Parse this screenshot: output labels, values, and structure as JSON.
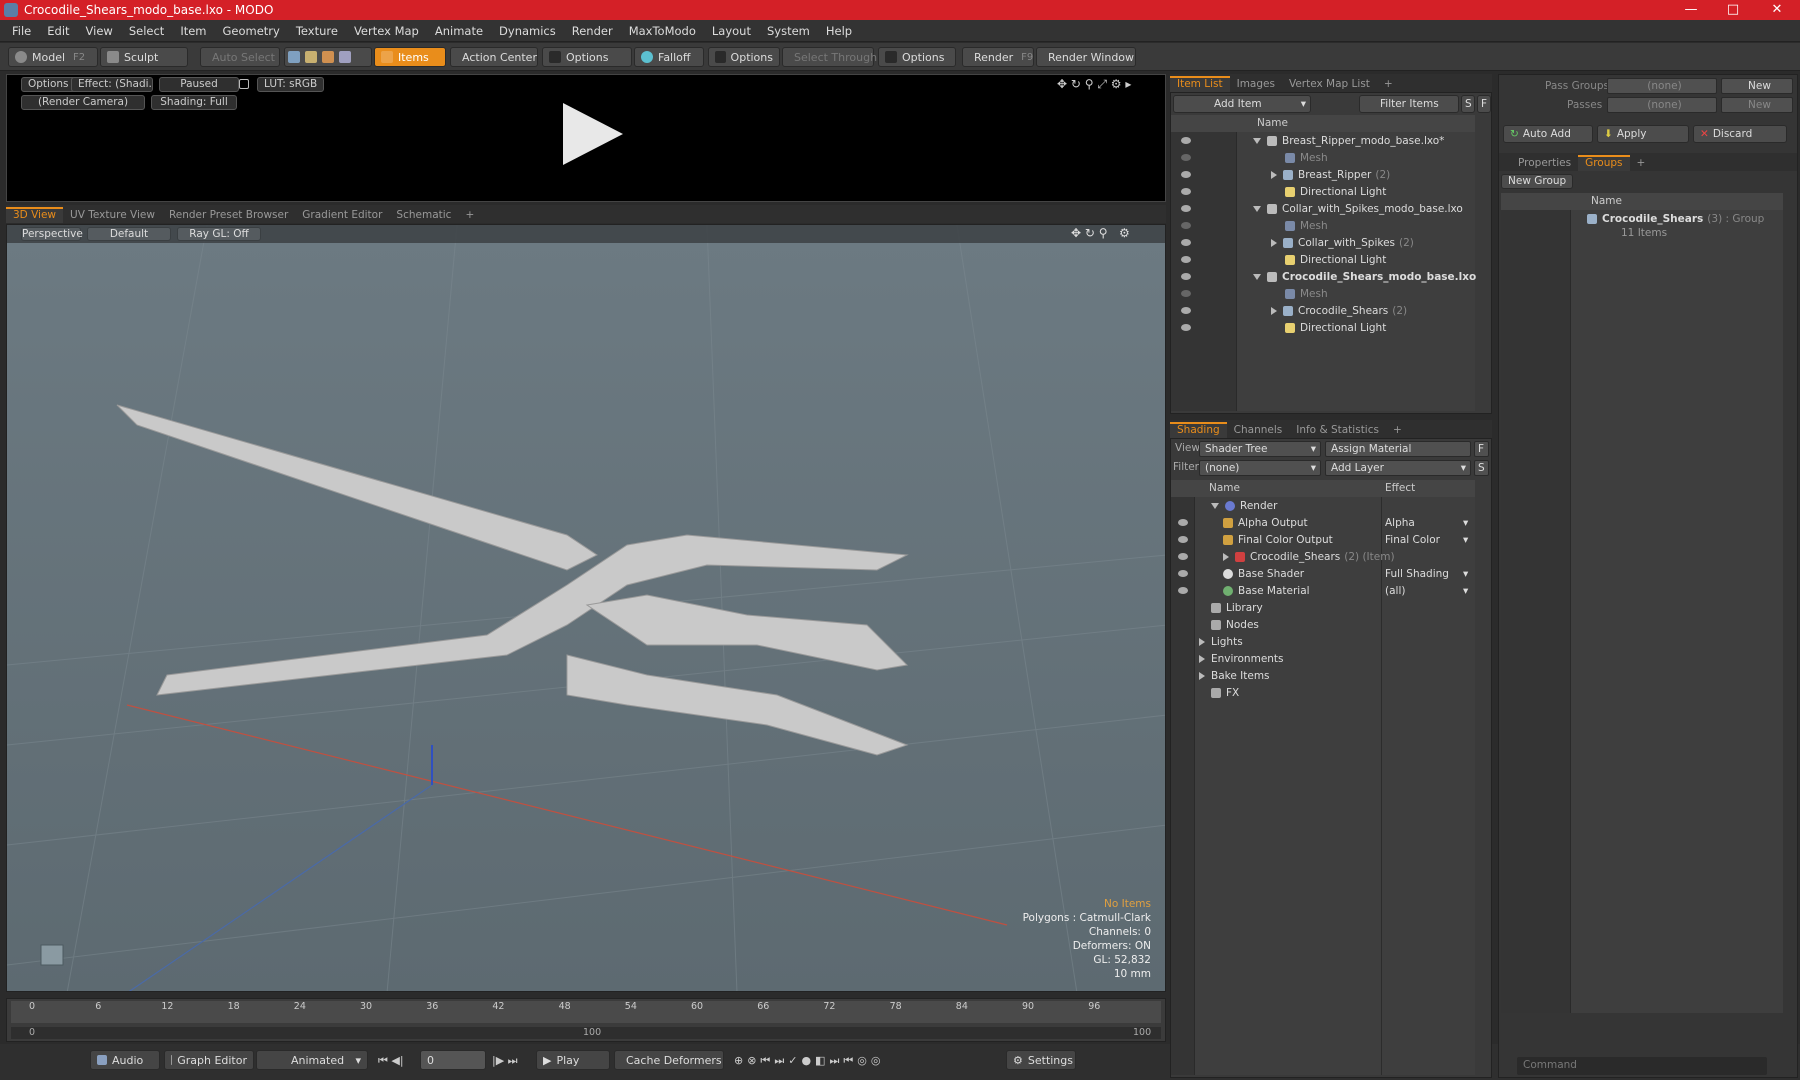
{
  "window": {
    "title": "Crocodile_Shears_modo_base.lxo - MODO",
    "minimize": "—",
    "maximize": "□",
    "close": "✕"
  },
  "menu": [
    "File",
    "Edit",
    "View",
    "Select",
    "Item",
    "Geometry",
    "Texture",
    "Vertex Map",
    "Animate",
    "Dynamics",
    "Render",
    "MaxToModo",
    "Layout",
    "System",
    "Help"
  ],
  "toolbar": {
    "model": "Model",
    "model_key": "F2",
    "sculpt": "Sculpt",
    "auto_select": "Auto Select",
    "items": "Items",
    "action_center": "Action Center",
    "options1": "Options",
    "falloff": "Falloff",
    "options2": "Options",
    "select_through": "Select Through",
    "options3": "Options",
    "render": "Render",
    "render_key": "F9",
    "render_window": "Render Window"
  },
  "preview": {
    "options": "Options",
    "effect": "Effect: (Shadi...",
    "paused": "Paused",
    "lut": "LUT: sRGB",
    "camera": "(Render Camera)",
    "shading": "Shading: Full"
  },
  "view_tabs": [
    "3D View",
    "UV Texture View",
    "Render Preset Browser",
    "Gradient Editor",
    "Schematic",
    "+"
  ],
  "viewport": {
    "perspective": "Perspective",
    "default": "Default",
    "raygl": "Ray GL: Off",
    "stats": {
      "no_items": "No Items",
      "polygons": "Polygons : Catmull-Clark",
      "channels": "Channels: 0",
      "deformers": "Deformers: ON",
      "gl": "GL: 52,832",
      "scale": "10 mm"
    }
  },
  "timeline": {
    "ticks": [
      "0",
      "6",
      "12",
      "18",
      "24",
      "30",
      "36",
      "42",
      "48",
      "54",
      "60",
      "66",
      "72",
      "78",
      "84",
      "90",
      "96"
    ],
    "low": "0",
    "mid": "100",
    "high": "100"
  },
  "bottom": {
    "audio": "Audio",
    "graph_editor": "Graph Editor",
    "animated": "Animated",
    "frame": "0",
    "play": "Play",
    "cache": "Cache Deformers",
    "settings": "Settings"
  },
  "item_list": {
    "tabs": [
      "Item List",
      "Images",
      "Vertex Map List",
      "+"
    ],
    "add_item": "Add Item",
    "filter_items": "Filter Items",
    "s": "S",
    "f": "F",
    "col_name": "Name",
    "rows": [
      {
        "label": "Breast_Ripper_modo_base.lxo*",
        "level": 0,
        "type": "scene"
      },
      {
        "label": "Mesh",
        "level": 1,
        "type": "mesh"
      },
      {
        "label": "Breast_Ripper",
        "count": "(2)",
        "level": 1,
        "type": "group"
      },
      {
        "label": "Directional Light",
        "level": 1,
        "type": "light"
      },
      {
        "label": "Collar_with_Spikes_modo_base.lxo",
        "level": 0,
        "type": "scene"
      },
      {
        "label": "Mesh",
        "level": 1,
        "type": "mesh"
      },
      {
        "label": "Collar_with_Spikes",
        "count": "(2)",
        "level": 1,
        "type": "group"
      },
      {
        "label": "Directional Light",
        "level": 1,
        "type": "light"
      },
      {
        "label": "Crocodile_Shears_modo_base.lxo",
        "level": 0,
        "type": "scene",
        "bold": true
      },
      {
        "label": "Mesh",
        "level": 1,
        "type": "mesh"
      },
      {
        "label": "Crocodile_Shears",
        "count": "(2)",
        "level": 1,
        "type": "group"
      },
      {
        "label": "Directional Light",
        "level": 1,
        "type": "light"
      }
    ]
  },
  "shading": {
    "tabs": [
      "Shading",
      "Channels",
      "Info & Statistics",
      "+"
    ],
    "view_label": "View",
    "view_value": "Shader Tree",
    "assign_material": "Assign Material",
    "filter_label": "Filter",
    "filter_value": "(none)",
    "add_layer": "Add Layer",
    "f": "F",
    "s": "S",
    "col_name": "Name",
    "col_effect": "Effect",
    "rows": [
      {
        "label": "Render",
        "effect": "",
        "level": 0
      },
      {
        "label": "Alpha Output",
        "effect": "Alpha",
        "level": 1
      },
      {
        "label": "Final Color Output",
        "effect": "Final Color",
        "level": 1
      },
      {
        "label": "Crocodile_Shears",
        "extra": "(2) (Item)",
        "effect": "",
        "level": 1
      },
      {
        "label": "Base Shader",
        "effect": "Full Shading",
        "level": 1
      },
      {
        "label": "Base Material",
        "effect": "(all)",
        "level": 1
      },
      {
        "label": "Library",
        "effect": "",
        "level": 0
      },
      {
        "label": "Nodes",
        "effect": "",
        "level": 0
      },
      {
        "label": "Lights",
        "effect": "",
        "level": -1
      },
      {
        "label": "Environments",
        "effect": "",
        "level": -1
      },
      {
        "label": "Bake Items",
        "effect": "",
        "level": -1
      },
      {
        "label": "FX",
        "effect": "",
        "level": 0
      }
    ]
  },
  "groups_panel": {
    "pass_groups": "Pass Groups",
    "passes": "Passes",
    "none": "(none)",
    "new": "New",
    "auto_add": "Auto Add",
    "apply": "Apply",
    "discard": "Discard",
    "tabs": [
      "Properties",
      "Groups",
      "+"
    ],
    "new_group": "New Group",
    "col_name": "Name",
    "group_name": "Crocodile_Shears",
    "group_meta": "(3) : Group",
    "group_items": "11 Items"
  },
  "command": {
    "placeholder": "Command"
  }
}
